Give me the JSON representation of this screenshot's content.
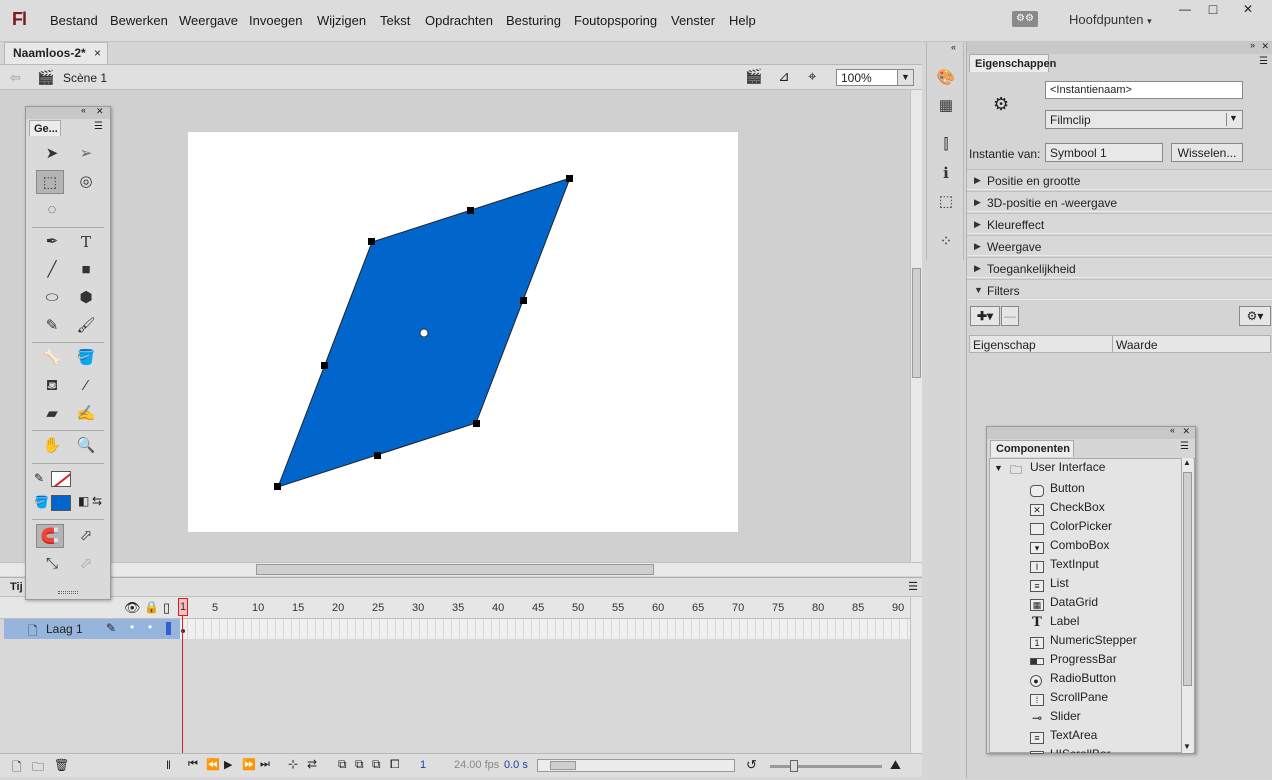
{
  "app": {
    "logo": "Fl"
  },
  "menu": [
    "Bestand",
    "Bewerken",
    "Weergave",
    "Invoegen",
    "Wijzigen",
    "Tekst",
    "Opdrachten",
    "Besturing",
    "Foutopsporing",
    "Venster",
    "Help"
  ],
  "workspace": {
    "label": "Hoofdpunten",
    "caret": "▾"
  },
  "window_controls": {
    "minimize": "—",
    "maximize": "□",
    "close": "✕"
  },
  "document": {
    "tab_title": "Naamloos-2*",
    "close_glyph": "×",
    "scene": "Scène 1",
    "zoom": "100%"
  },
  "colors": {
    "shape_fill": "#0066cc",
    "selection_handle": "#000000",
    "accent_red": "#e02020"
  },
  "timeline": {
    "tab_label": "Tij",
    "frame_numbers": [
      "1",
      "5",
      "10",
      "15",
      "20",
      "25",
      "30",
      "35",
      "40",
      "45",
      "50",
      "55",
      "60",
      "65",
      "70",
      "75",
      "80",
      "85",
      "90"
    ],
    "layer_name": "Laag 1",
    "current_frame": "1",
    "fps": "24.00 fps",
    "time": "0.0 s"
  },
  "tools_panel": {
    "tab_label": "Ge..."
  },
  "properties": {
    "tab_label": "Eigenschappen",
    "instance_name_placeholder": "<Instantienaam>",
    "type_value": "Filmclip",
    "instance_of_label": "Instantie van:",
    "instance_of_value": "Symbool 1",
    "swap_button": "Wisselen...",
    "sections": [
      {
        "label": "Positie en grootte",
        "open": false
      },
      {
        "label": "3D-positie en -weergave",
        "open": false
      },
      {
        "label": "Kleureffect",
        "open": false
      },
      {
        "label": "Weergave",
        "open": false
      },
      {
        "label": "Toegankelijkheid",
        "open": false
      },
      {
        "label": "Filters",
        "open": true
      }
    ],
    "filters_table": {
      "col_property": "Eigenschap",
      "col_value": "Waarde"
    }
  },
  "components_panel": {
    "tab_label": "Componenten",
    "folder": "User Interface",
    "items": [
      "Button",
      "CheckBox",
      "ColorPicker",
      "ComboBox",
      "TextInput",
      "List",
      "DataGrid",
      "Label",
      "NumericStepper",
      "ProgressBar",
      "RadioButton",
      "ScrollPane",
      "Slider",
      "TextArea",
      "UIScrollBar"
    ]
  }
}
